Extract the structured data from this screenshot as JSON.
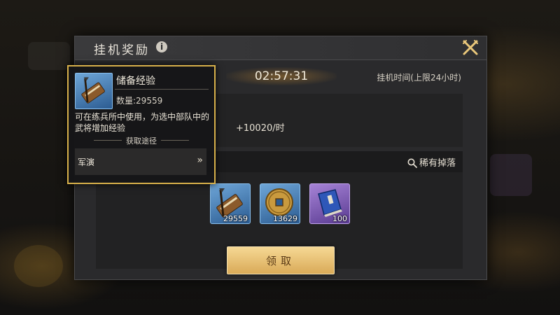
{
  "panel": {
    "title": "挂机奖励",
    "timer": "02:57:31",
    "limit_text": "挂机时间(上限24小时)",
    "rate_text": "+10020/时",
    "rare_drop_label": "稀有掉落",
    "claim_label": "领取"
  },
  "items": [
    {
      "name": "储备经验",
      "icon": "war-scroll-icon",
      "count": "29559",
      "rarity": "blue"
    },
    {
      "name": "coin",
      "icon": "copper-coin-icon",
      "count": "13629",
      "rarity": "blue"
    },
    {
      "name": "book",
      "icon": "blue-book-icon",
      "count": "100",
      "rarity": "purple"
    }
  ],
  "tooltip": {
    "item_name": "储备经验",
    "quantity": "数量:29559",
    "description": "可在练兵所中使用，为选中部队中的武将增加经验",
    "obtain_way": "获取途径",
    "source": "军演",
    "source_arrow": "»"
  },
  "colors": {
    "tooltip_border": "#d7b04a",
    "claim_button": "#e8bf6e",
    "panel_bg": "#2a2a2c"
  }
}
